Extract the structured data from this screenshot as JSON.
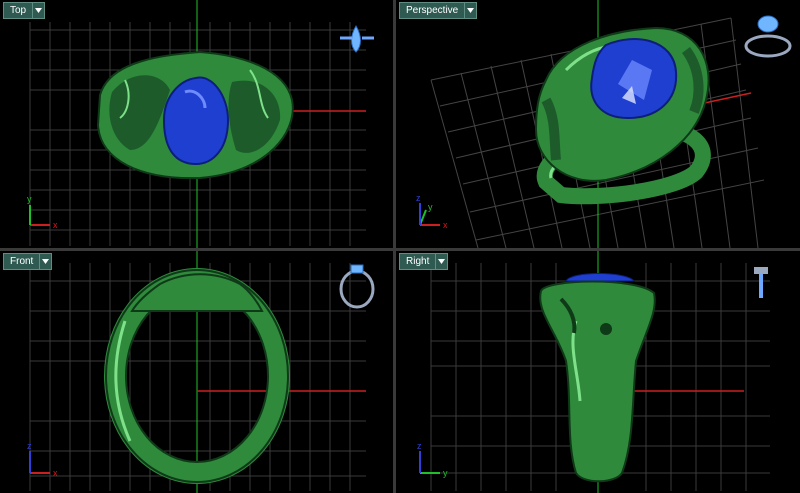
{
  "viewports": {
    "top": {
      "label": "Top"
    },
    "perspective": {
      "label": "Perspective"
    },
    "front": {
      "label": "Front"
    },
    "right": {
      "label": "Right"
    }
  },
  "axis_labels": {
    "top": {
      "x": "x",
      "y": "y"
    },
    "perspective": {
      "x": "x",
      "y": "y",
      "z": "z"
    },
    "front": {
      "x": "x",
      "z": "z"
    },
    "right": {
      "y": "y",
      "z": "z"
    }
  },
  "colors": {
    "metal": "#2f8a3c",
    "metal_highlight": "#7fe08a",
    "metal_shadow": "#0f3a18",
    "gem": "#1f3fd0",
    "gem_highlight": "#6f8cff",
    "grid": "#3a3a3a",
    "grid_major": "#555555",
    "axis_x": "#cc1f1f",
    "axis_y": "#1fbf2a",
    "axis_z": "#2f3fd8",
    "label_bg": "#2e5a52"
  }
}
